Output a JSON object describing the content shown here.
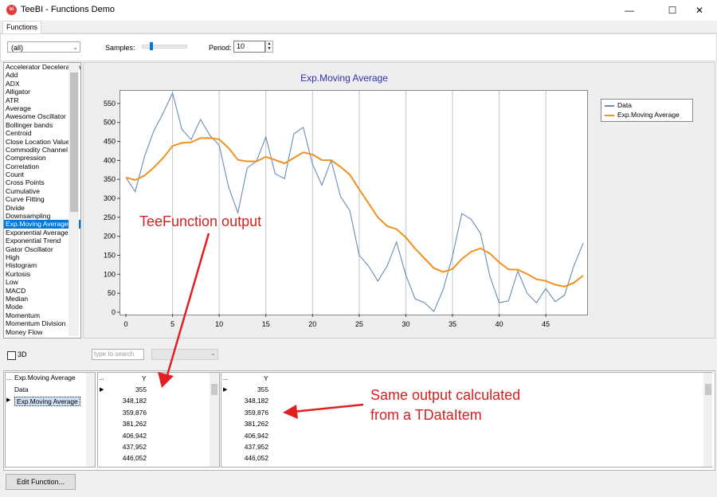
{
  "window": {
    "title": "TeeBI - Functions Demo",
    "app_icon": "tee",
    "controls": [
      "minimize-icon",
      "maximize-icon",
      "close-icon"
    ]
  },
  "tabs": [
    "Functions"
  ],
  "toolbar": {
    "filter_value": "(all)",
    "samples_label": "Samples:",
    "samples_position": 0.18,
    "period_label": "Period:",
    "period_value": "10"
  },
  "functions_list": {
    "items": [
      "Accelerator Deceleration",
      "Add",
      "ADX",
      "Alligator",
      "ATR",
      "Average",
      "Awesome Oscillator",
      "Bollinger bands",
      "Centroid",
      "Close Location Value",
      "Commodity Channel",
      "Compression",
      "Correlation",
      "Count",
      "Cross Points",
      "Cumulative",
      "Curve Fitting",
      "Divide",
      "Downsampling",
      "Exp.Moving Average",
      "Exponential Average",
      "Exponential Trend",
      "Gator Oscillator",
      "High",
      "Histogram",
      "Kurtosis",
      "Low",
      "MACD",
      "Median",
      "Mode",
      "Momentum",
      "Momentum Division",
      "Money Flow"
    ],
    "selected": "Exp.Moving Average"
  },
  "chart_data": {
    "type": "line",
    "title": "Exp.Moving Average",
    "xlim": [
      0,
      49
    ],
    "ylim": [
      0,
      575
    ],
    "xticks": [
      0,
      5,
      10,
      15,
      20,
      25,
      30,
      35,
      40,
      45
    ],
    "yticks": [
      0,
      50,
      100,
      150,
      200,
      250,
      300,
      350,
      400,
      450,
      500,
      550
    ],
    "grid": "vertical",
    "legend": "top-right",
    "series": [
      {
        "name": "Data",
        "color": "#6b8bb3",
        "x": [
          0,
          1,
          2,
          3,
          4,
          5,
          6,
          7,
          8,
          9,
          10,
          11,
          12,
          13,
          14,
          15,
          16,
          17,
          18,
          19,
          20,
          21,
          22,
          23,
          24,
          25,
          26,
          27,
          28,
          29,
          30,
          31,
          32,
          33,
          34,
          35,
          36,
          37,
          38,
          39,
          40,
          41,
          42,
          43,
          44,
          45,
          46,
          47,
          48,
          49
        ],
        "values": [
          355,
          318,
          410,
          478,
          525,
          578,
          482,
          455,
          508,
          466,
          440,
          330,
          262,
          380,
          398,
          462,
          365,
          352,
          470,
          487,
          390,
          335,
          400,
          305,
          268,
          150,
          122,
          82,
          122,
          185,
          98,
          35,
          25,
          2,
          60,
          148,
          260,
          245,
          208,
          95,
          25,
          30,
          108,
          50,
          25,
          62,
          28,
          45,
          122,
          182
        ]
      },
      {
        "name": "Exp.Moving Average",
        "color": "#f29020",
        "x": [
          0,
          1,
          2,
          3,
          4,
          5,
          6,
          7,
          8,
          9,
          10,
          11,
          12,
          13,
          14,
          15,
          16,
          17,
          18,
          19,
          20,
          21,
          22,
          23,
          24,
          25,
          26,
          27,
          28,
          29,
          30,
          31,
          32,
          33,
          34,
          35,
          36,
          37,
          38,
          39,
          40,
          41,
          42,
          43,
          44,
          45,
          46,
          47,
          48,
          49
        ],
        "values": [
          355,
          348.182,
          359.876,
          381.262,
          406.942,
          437.952,
          446.052,
          447.679,
          458.647,
          459.059,
          455.594,
          432.758,
          401.347,
          397.466,
          397.563,
          409.373,
          401.303,
          392.321,
          406.444,
          421.089,
          415.437,
          400.812,
          400.665,
          383.272,
          362.495,
          323.86,
          287.158,
          249.857,
          226.61,
          219.044,
          197.036,
          167.485,
          141.565,
          116.19,
          106.155,
          113.763,
          140.351,
          159.378,
          168.219,
          154.906,
          131.287,
          112.871,
          112.0,
          100.727,
          86.958,
          82.42,
          72.525,
          67.521,
          77.425,
          96.438
        ]
      }
    ]
  },
  "options": {
    "3d_label": "3D",
    "search_placeholder": "type to search"
  },
  "tree": {
    "header": "Exp.Moving Average",
    "items": [
      "Data",
      "Exp.Moving Average"
    ],
    "selected": "Exp.Moving Average"
  },
  "grid_left": {
    "column": "Y",
    "rows": [
      "355",
      "348,182",
      "359,876",
      "381,262",
      "406,942",
      "437,952",
      "446,052"
    ]
  },
  "grid_right": {
    "column": "Y",
    "rows": [
      "355",
      "348,182",
      "359,876",
      "381,262",
      "406,942",
      "437,952",
      "446,052"
    ]
  },
  "annotations": {
    "top": "TeeFunction output",
    "right_line1": "Same output calculated",
    "right_line2": "from a TDataItem",
    "color": "#d42121"
  },
  "buttons": {
    "edit_function": "Edit Function..."
  }
}
